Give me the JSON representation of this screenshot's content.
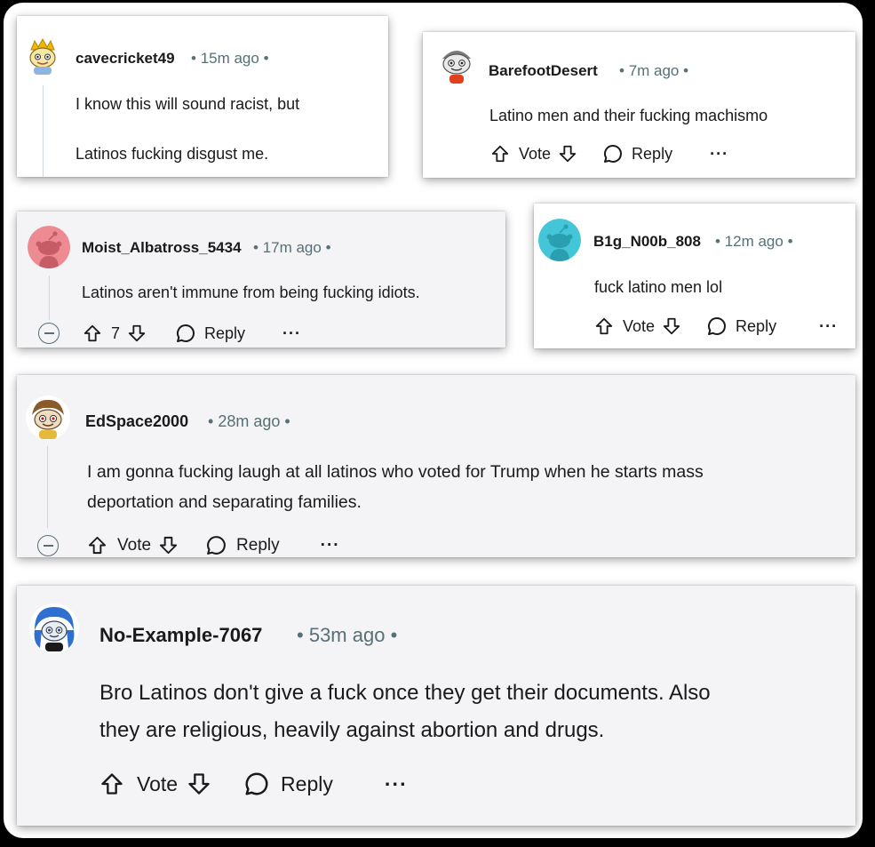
{
  "comments": [
    {
      "username": "cavecricket49",
      "time": "15m ago",
      "lines": [
        "I know this will sound racist, but",
        "Latinos fucking disgust me."
      ],
      "avatar_icon": "snoo-yellow-avatar"
    },
    {
      "username": "BarefootDesert",
      "time": "7m ago",
      "lines": [
        "Latino men and their fucking machismo"
      ],
      "vote_label": "Vote",
      "reply_label": "Reply",
      "avatar_icon": "snoo-gray-avatar"
    },
    {
      "username": "Moist_Albatross_5434",
      "time": "17m ago",
      "lines": [
        "Latinos aren't immune from being fucking idiots."
      ],
      "vote_count": "7",
      "reply_label": "Reply",
      "avatar_icon": "snoo-pink-avatar"
    },
    {
      "username": "B1g_N00b_808",
      "time": "12m ago",
      "lines": [
        "fuck latino men lol"
      ],
      "vote_label": "Vote",
      "reply_label": "Reply",
      "avatar_icon": "snoo-teal-avatar"
    },
    {
      "username": "EdSpace2000",
      "time": "28m ago",
      "lines": [
        "I am gonna fucking laugh at all latinos who voted for Trump when he starts mass",
        "deportation and separating families."
      ],
      "vote_label": "Vote",
      "reply_label": "Reply",
      "avatar_icon": "snoo-brown-hair-avatar"
    },
    {
      "username": "No-Example-7067",
      "time": "53m ago",
      "lines": [
        "Bro Latinos don't give a fuck once they get their documents. Also",
        "they are religious, heavily against abortion and drugs."
      ],
      "vote_label": "Vote",
      "reply_label": "Reply",
      "avatar_icon": "snoo-blue-hair-avatar"
    }
  ],
  "separator": "•",
  "more_label": "···",
  "colors": {
    "text": "#1a1a1b",
    "meta": "#576f76",
    "pink_avatar": "#ee8a92",
    "teal_avatar": "#44c6d8"
  }
}
